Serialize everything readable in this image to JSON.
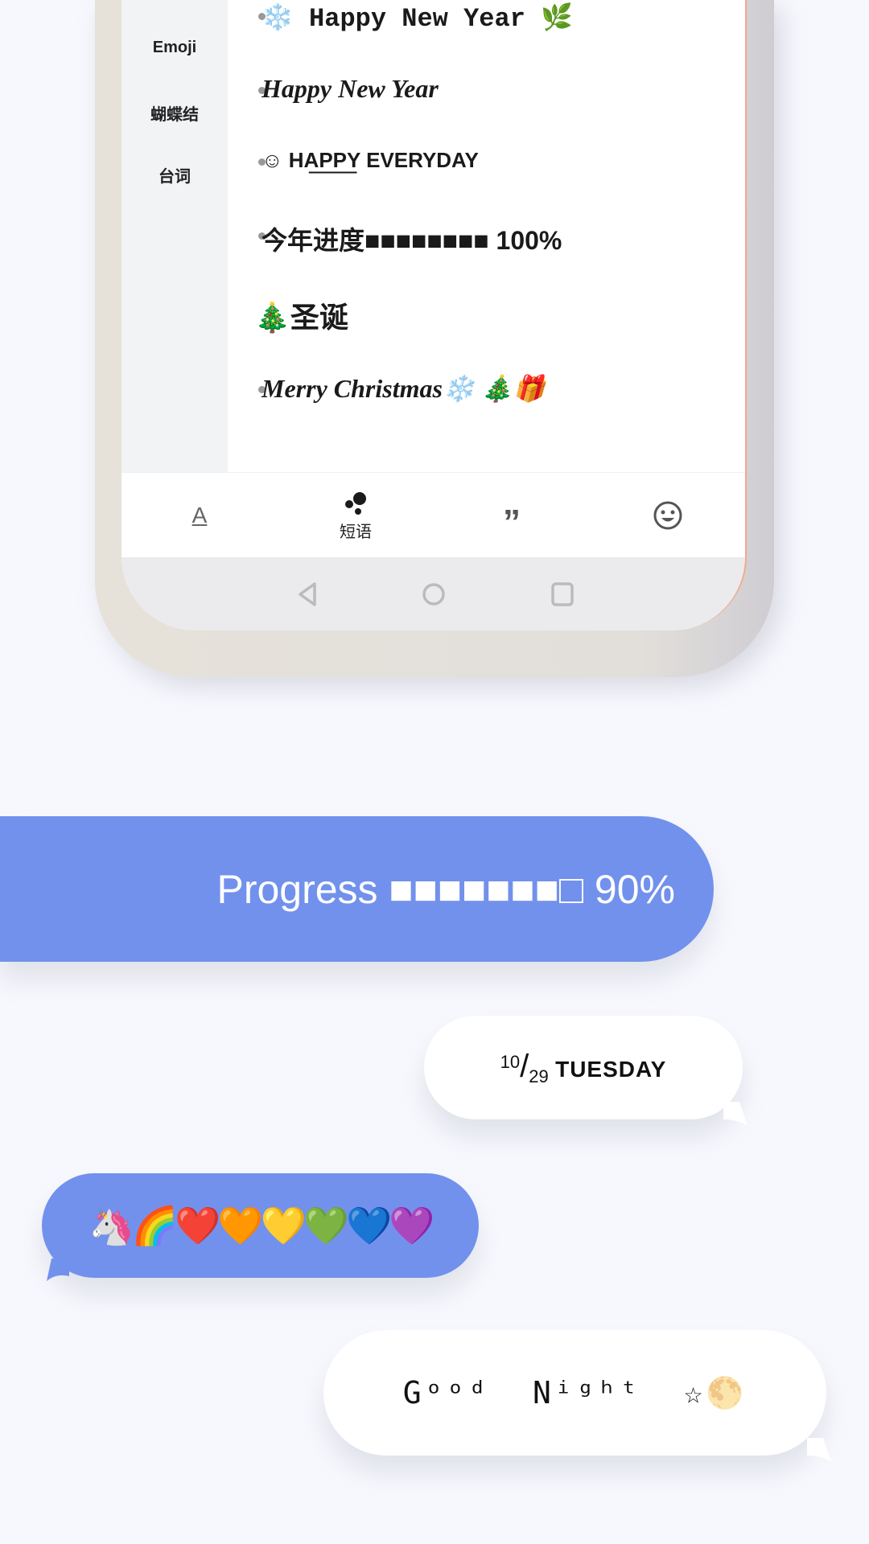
{
  "sidebar": {
    "items": [
      {
        "label": "Emoji"
      },
      {
        "label": "蝴蝶结"
      },
      {
        "label": "台词"
      }
    ]
  },
  "content": {
    "items": [
      {
        "text": "❄️ Happy New Year 🌿"
      },
      {
        "text": "Happy New Year"
      },
      {
        "text": "☺ HA͟P͟P͟Y EVERYDAY"
      },
      {
        "text": "今年进度■■■■■■■■ 100%"
      }
    ],
    "section_title": "🎄圣诞",
    "section_items": [
      {
        "text": "Merry Christmas❄️ 🎄🎁"
      }
    ]
  },
  "tabbar": {
    "tabs": [
      {
        "icon": "font-a-icon",
        "label": ""
      },
      {
        "icon": "bubbles-icon",
        "label": "短语"
      },
      {
        "icon": "quote-icon",
        "label": ""
      },
      {
        "icon": "smiley-icon",
        "label": ""
      }
    ],
    "active": 1
  },
  "navbar": {
    "icons": [
      "back-icon",
      "home-icon",
      "recents-icon"
    ]
  },
  "bubbles": {
    "progress": "Progress ■■■■■■■□ 90%",
    "date": {
      "num": "10",
      "den": "29",
      "day": "TUESDAY"
    },
    "emoji": "🦄🌈❤️🧡💛💚💙💜",
    "goodnight": "Gᵒᵒᵈ  Nⁱᵍʰᵗ  ☆🌕"
  },
  "colors": {
    "accent": "#7291ed",
    "background": "#f7f8fd"
  }
}
